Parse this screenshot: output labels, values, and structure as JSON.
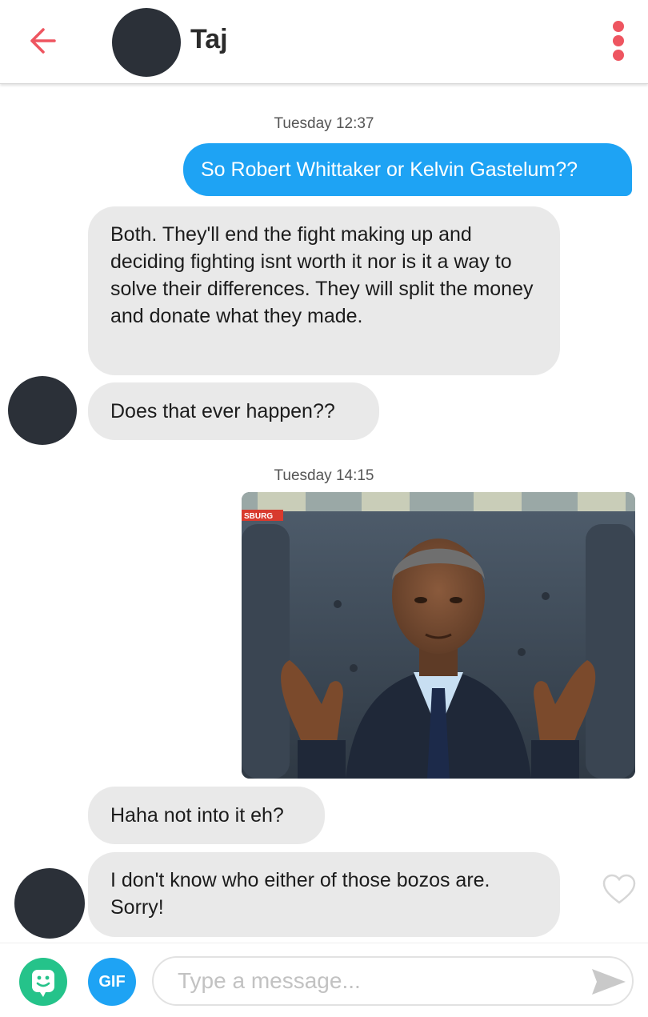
{
  "header": {
    "contact_name": "Taj",
    "back_icon": "arrow-left-icon",
    "more_icon": "more-vertical-icon",
    "accent_color": "#ee5560"
  },
  "messages": [
    {
      "type": "timestamp",
      "text": "Tuesday 12:37"
    },
    {
      "type": "outgoing",
      "text": "So Robert Whittaker or Kelvin Gastelum??"
    },
    {
      "type": "incoming",
      "text": "Both. They'll end the fight making up and deciding fighting isnt worth it nor is it a way to solve their differences. They will split the money and donate what they made."
    },
    {
      "type": "incoming",
      "text": "Does that ever happen??"
    },
    {
      "type": "timestamp",
      "text": "Tuesday 14:15"
    },
    {
      "type": "outgoing-gif",
      "overlay_text": "SBURG"
    },
    {
      "type": "incoming",
      "text": "Haha not into it eh?"
    },
    {
      "type": "incoming",
      "text": "I don't know who either of those bozos are. Sorry!"
    }
  ],
  "composer": {
    "sticker_icon": "sticker-face-icon",
    "gif_label": "GIF",
    "placeholder": "Type a message...",
    "send_icon": "send-icon"
  },
  "colors": {
    "outgoing_bubble": "#1ea3f4",
    "incoming_bubble": "#e9e9e9",
    "sticker_button": "#25c38a"
  }
}
